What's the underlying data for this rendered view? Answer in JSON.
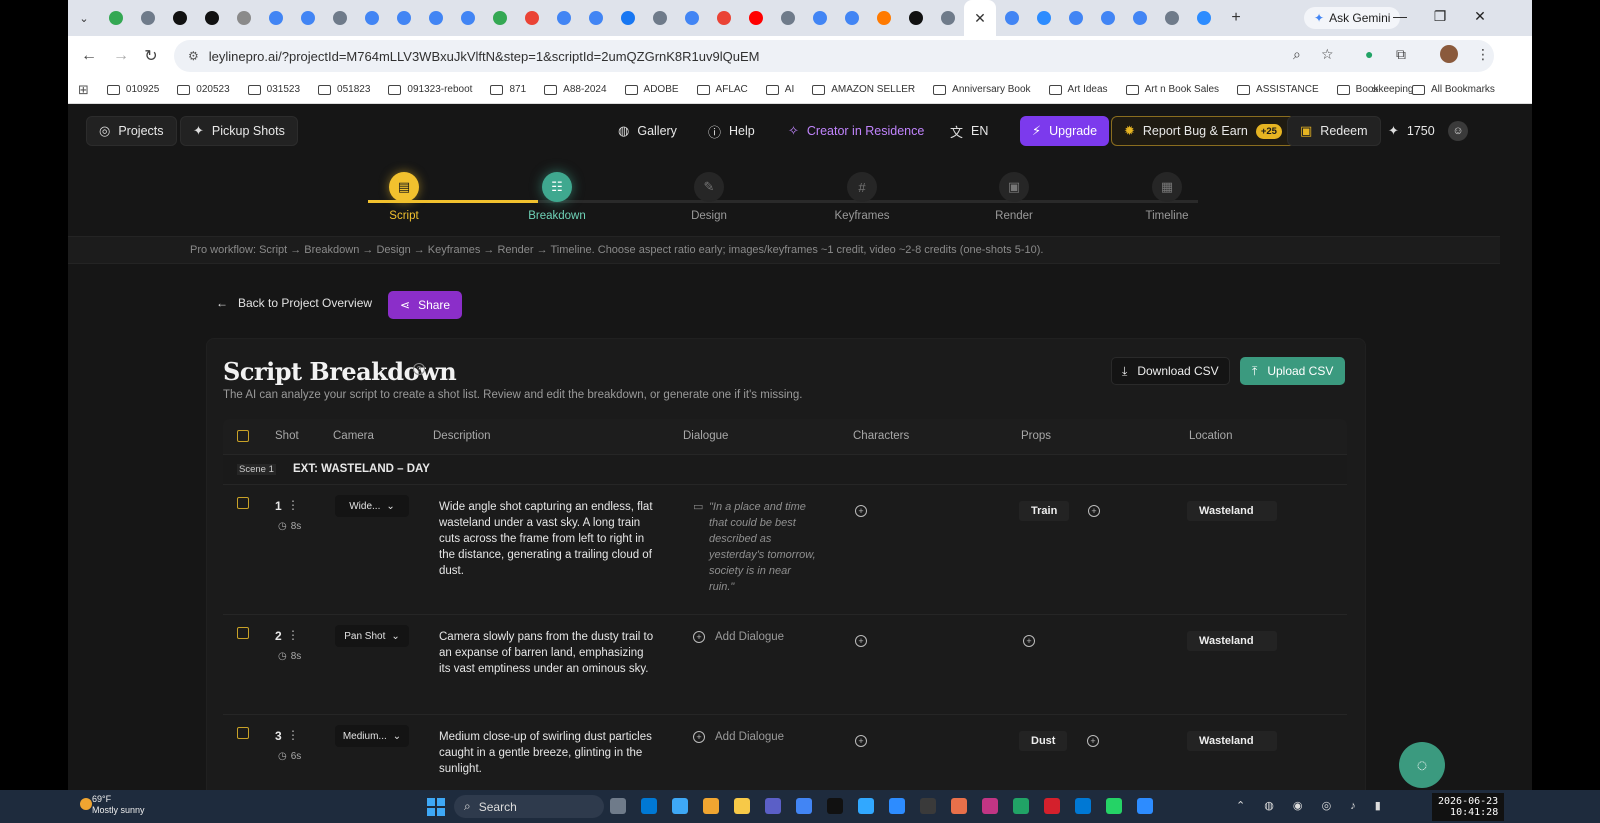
{
  "browser": {
    "url": "leylinepro.ai/?projectId=M764mLLV3WBxuJkVlftN&step=1&scriptId=2umQZGrnK8R1uv9lQuEM",
    "ask_gemini": "Ask Gemini",
    "tab_icon_colors": [
      "#34a853",
      "#6f7b8a",
      "#111111",
      "#111111",
      "#8a8a8a",
      "#4285f4",
      "#4285f4",
      "#6f7b8a",
      "#4285f4",
      "#4285f4",
      "#4285f4",
      "#4285f4",
      "#34a853",
      "#ea4335",
      "#4285f4",
      "#4285f4",
      "#1877f2",
      "#6f7b8a",
      "#4285f4",
      "#ea4335",
      "#ff0000",
      "#6f7b8a",
      "#4285f4",
      "#4285f4",
      "#ff7a00",
      "#111111",
      "#6f7b8a"
    ],
    "tab_icon_colors_after": [
      "#4285f4",
      "#2d8cff",
      "#4285f4",
      "#4285f4",
      "#4285f4",
      "#6f7b8a",
      "#2d8cff"
    ],
    "close_tab_glyph": "✕",
    "new_tab_glyph": "+",
    "bookmarks": [
      "010925",
      "020523",
      "031523",
      "051823",
      "091323-reboot",
      "871",
      "A88-2024",
      "ADOBE",
      "AFLAC",
      "AI",
      "AMAZON SELLER",
      "Anniversary Book",
      "Art Ideas",
      "Art n Book Sales",
      "ASSISTANCE",
      "Bookkeeping"
    ],
    "all_bookmarks": "All Bookmarks"
  },
  "nav": {
    "projects": "Projects",
    "pickup_shots": "Pickup Shots",
    "gallery": "Gallery",
    "help": "Help",
    "creator": "Creator in Residence",
    "language": "EN",
    "upgrade": "Upgrade",
    "report": "Report Bug & Earn",
    "report_badge": "+25",
    "redeem": "Redeem",
    "credits": "1750"
  },
  "steps": [
    {
      "label": "Script",
      "state": "done",
      "icon": "scroll-icon",
      "glyph": "▤"
    },
    {
      "label": "Breakdown",
      "state": "current",
      "icon": "list-icon",
      "glyph": "☷"
    },
    {
      "label": "Design",
      "state": "todo",
      "icon": "brush-icon",
      "glyph": "✎"
    },
    {
      "label": "Keyframes",
      "state": "todo",
      "icon": "frame-icon",
      "glyph": "#"
    },
    {
      "label": "Render",
      "state": "todo",
      "icon": "clapper-icon",
      "glyph": "▣"
    },
    {
      "label": "Timeline",
      "state": "todo",
      "icon": "film-icon",
      "glyph": "▦"
    }
  ],
  "workflow_tip": "Pro workflow: Script → Breakdown → Design → Keyframes → Render → Timeline. Choose aspect ratio early; images/keyframes ~1 credit, video ~2-8 credits (one-shots 5-10).",
  "back_link": "Back to Project Overview",
  "share": "Share",
  "card": {
    "title": "Script Breakdown",
    "subtitle": "The AI can analyze your script to create a shot list. Review and edit the breakdown, or generate one if it's missing.",
    "download_csv": "Download CSV",
    "upload_csv": "Upload CSV"
  },
  "table": {
    "headers": {
      "shot": "Shot",
      "camera": "Camera",
      "description": "Description",
      "dialogue": "Dialogue",
      "characters": "Characters",
      "props": "Props",
      "location": "Location"
    },
    "scene": {
      "badge": "Scene 1",
      "name": "EXT: WASTELAND – DAY"
    },
    "rows": [
      {
        "shot": "1",
        "duration": "8s",
        "camera": "Wide...",
        "description": "Wide angle shot capturing an endless, flat wasteland under a vast sky. A long train cuts across the frame from left to right in the distance, generating a trailing cloud of dust.",
        "dialogue": "\"In a place and time that could be best described as yesterday's tomorrow, society is in near ruin.\"",
        "props": "Train",
        "location": "Wasteland"
      },
      {
        "shot": "2",
        "duration": "8s",
        "camera": "Pan Shot",
        "description": "Camera slowly pans from the dusty trail to an expanse of barren land, emphasizing its vast emptiness under an ominous sky.",
        "add_dialogue": "Add Dialogue",
        "location": "Wasteland"
      },
      {
        "shot": "3",
        "duration": "6s",
        "camera": "Medium...",
        "description": "Medium close-up of swirling dust particles caught in a gentle breeze, glinting in the sunlight.",
        "add_dialogue": "Add Dialogue",
        "props": "Dust",
        "location": "Wasteland"
      }
    ]
  },
  "taskbar": {
    "temp": "69°F",
    "weather": "Mostly sunny",
    "search": "Search",
    "date": "2026-06-23",
    "time": "10:41:28",
    "app_colors": [
      "#6f7b8a",
      "#0078d4",
      "#3ea8f6",
      "#f0a531",
      "#f7c948",
      "#5b5fc7",
      "#4285f4",
      "#111111",
      "#31a8ff",
      "#2d8cff",
      "#3a3a3a",
      "#e8704a",
      "#c13584",
      "#21a366",
      "#d4202c",
      "#0078d4",
      "#25d366",
      "#2d8cff"
    ]
  },
  "colors": {
    "accent_teal": "#3b9a7f",
    "accent_gold": "#f2c12e",
    "accent_purple": "#7c3aed"
  }
}
